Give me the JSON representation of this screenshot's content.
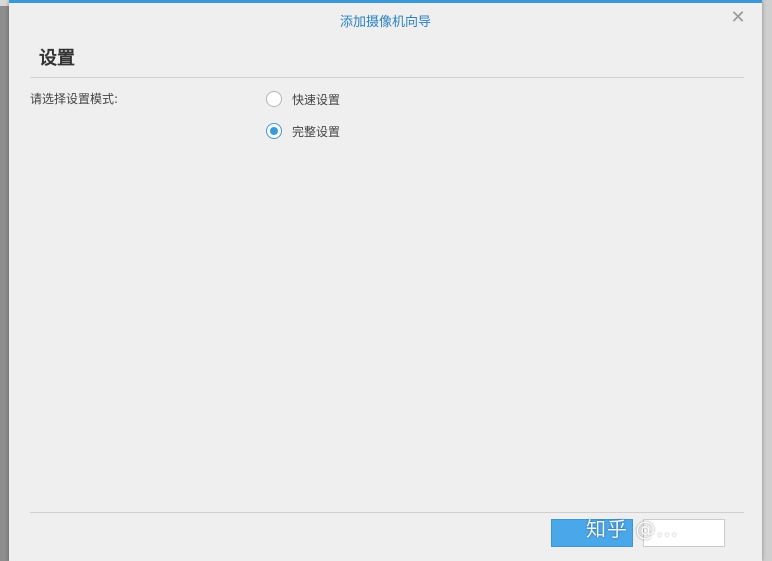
{
  "dialog": {
    "title": "添加摄像机向导",
    "close_icon": "close-icon",
    "heading": "设置",
    "prompt": "请选择设置模式:",
    "options": [
      {
        "label": "快速设置",
        "selected": false
      },
      {
        "label": "完整设置",
        "selected": true
      }
    ],
    "accent_color": "#3a9ad9"
  },
  "watermark": {
    "text": "知乎 @..."
  }
}
